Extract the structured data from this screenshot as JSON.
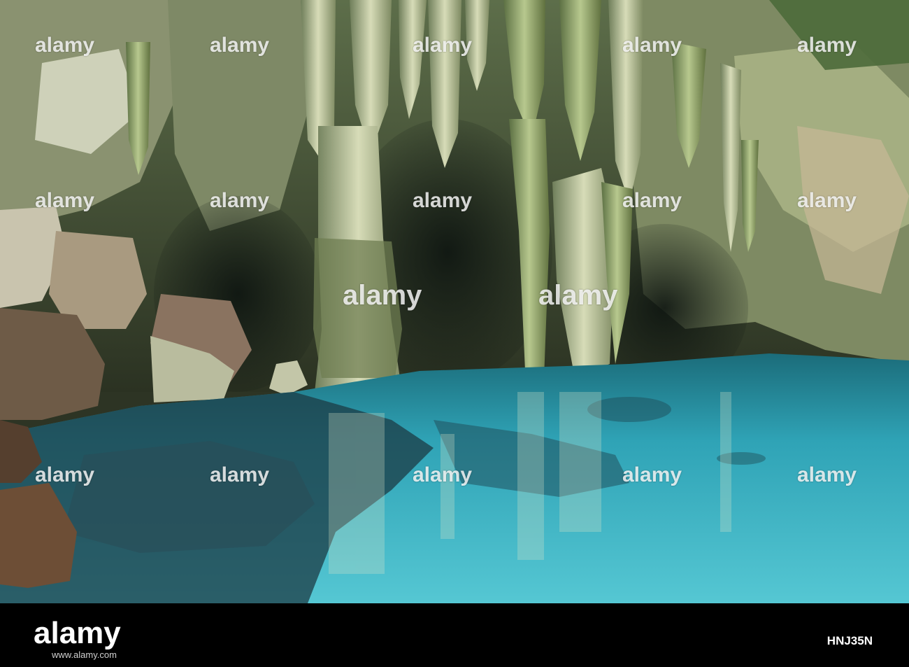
{
  "watermark": {
    "text": "alamy"
  },
  "footer": {
    "logo": "alamy",
    "sub": "www.alamy.com",
    "image_id": "HNJ35N"
  },
  "colors": {
    "water": "#3ab6c8",
    "cave_rock": "#b4c19a",
    "footer_bg": "#000000"
  }
}
